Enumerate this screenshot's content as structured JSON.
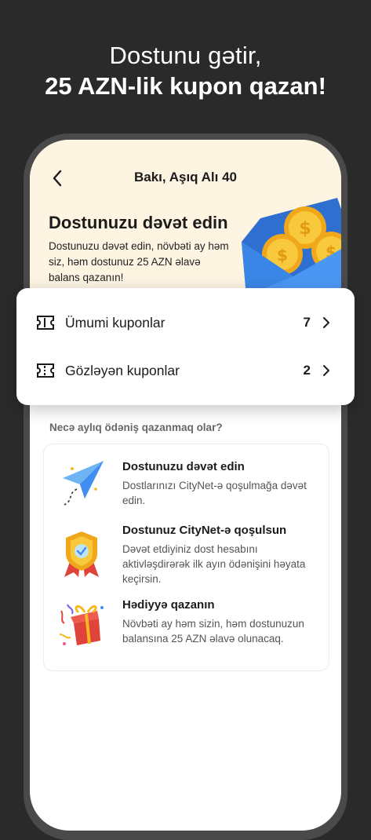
{
  "promo": {
    "headline_line1": "Dostunu gətir,",
    "headline_line2": "25 AZN-lik kupon qazan!"
  },
  "nav": {
    "title": "Bakı, Aşıq Alı 40"
  },
  "invite": {
    "title": "Dostunuzu dəvət edin",
    "description": "Dostunuzu dəvət edin, növbəti ay həm siz, həm dostunuz 25 AZN əlavə balans qazanın!"
  },
  "coupons": [
    {
      "label": "Ümumi kuponlar",
      "count": "7",
      "icon": "ticket-icon"
    },
    {
      "label": "Gözləyən kuponlar",
      "count": "2",
      "icon": "ticket-pending-icon"
    }
  ],
  "how": {
    "title": "Necə aylıq ödəniş qazanmaq olar?",
    "steps": [
      {
        "title": "Dostunuzu dəvət edin",
        "desc": "Dostlarınızı CityNet-ə qoşulmağa dəvət edin.",
        "icon": "paper-plane-icon"
      },
      {
        "title": "Dostunuz CityNet-ə qoşulsun",
        "desc": "Dəvət etdiyiniz dost hesabını aktivləşdirərək ilk ayın ödənişini həyata keçirsin.",
        "icon": "badge-icon"
      },
      {
        "title": "Hədiyyə qazanın",
        "desc": "Növbəti ay həm sizin, həm dostunuzun balansına 25 AZN əlavə olunacaq.",
        "icon": "gift-icon"
      }
    ]
  },
  "colors": {
    "background": "#2a2a2a",
    "header_bg": "#fdf4e2",
    "envelope": "#3f8ef0",
    "coin": "#f5b821"
  }
}
